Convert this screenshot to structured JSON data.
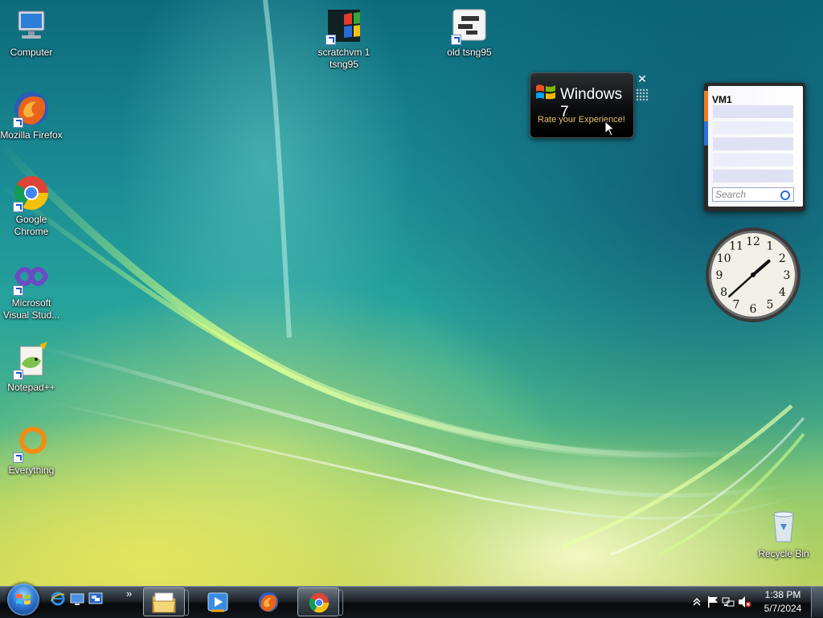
{
  "desktop": {
    "icons": [
      {
        "id": "computer",
        "label": "Computer"
      },
      {
        "id": "firefox",
        "label": "Mozilla Firefox"
      },
      {
        "id": "chrome",
        "label": "Google Chrome"
      },
      {
        "id": "visual-studio",
        "label": "Microsoft Visual Stud..."
      },
      {
        "id": "notepadpp",
        "label": "Notepad++"
      },
      {
        "id": "everything",
        "label": "Everything"
      },
      {
        "id": "scratchvm",
        "label": "scratchvm 1 tsng95"
      },
      {
        "id": "old-tsng95",
        "label": "old tsng95"
      },
      {
        "id": "recycle-bin",
        "label": "Recycle Bin"
      }
    ]
  },
  "gadgets": {
    "windows7": {
      "title": "Windows 7",
      "subtitle": "Rate your Experience!",
      "close_glyph": "✕"
    },
    "feed": {
      "title": "VM1",
      "search_placeholder": "Search"
    },
    "clock": {
      "numerals": [
        "12",
        "1",
        "2",
        "3",
        "4",
        "5",
        "6",
        "7",
        "8",
        "9",
        "10",
        "11"
      ],
      "hour": 1,
      "minute": 38
    }
  },
  "taskbar": {
    "quick_launch": [
      "ie-icon",
      "show-desktop-icon",
      "switch-windows-icon"
    ],
    "overflow_glyph": "»",
    "buttons": [
      {
        "id": "explorer",
        "icon": "folder-icon",
        "active": true
      },
      {
        "id": "media-player",
        "icon": "media-player-icon",
        "active": false
      },
      {
        "id": "firefox",
        "icon": "firefox-icon",
        "active": false
      },
      {
        "id": "chrome",
        "icon": "chrome-icon",
        "active": true
      }
    ],
    "tray": {
      "icons": [
        "show-hidden-icons-chevron",
        "action-center-flag-icon",
        "network-icon",
        "volume-muted-icon"
      ],
      "time": "1:38 PM",
      "date": "5/7/2024"
    }
  },
  "colors": {
    "accent_gold": "#e6c06a",
    "clock_face": "#f2f0e6"
  }
}
